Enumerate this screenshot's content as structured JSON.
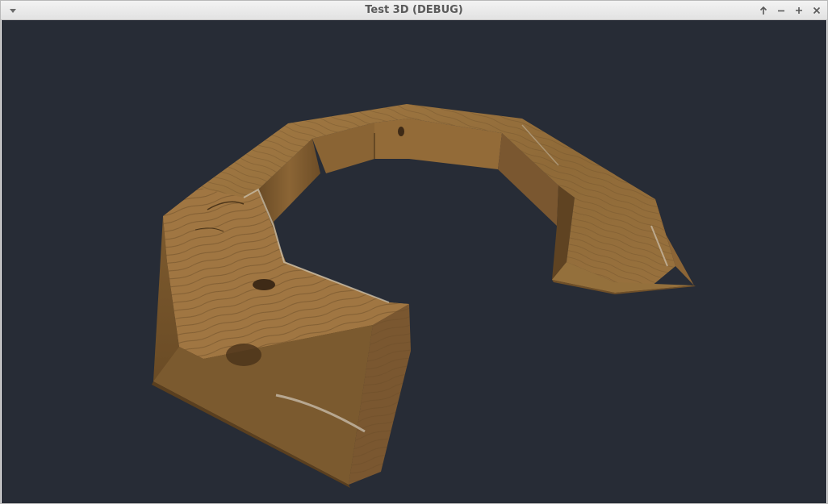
{
  "window": {
    "title": "Test 3D (DEBUG)"
  },
  "title_controls": [
    {
      "name": "window-menu-button",
      "icon": "chevron-down-icon"
    },
    {
      "name": "keep-above-button",
      "icon": "arrow-up-icon"
    },
    {
      "name": "minimize-button",
      "icon": "minus-icon"
    },
    {
      "name": "maximize-button",
      "icon": "plus-icon"
    },
    {
      "name": "close-button",
      "icon": "close-icon"
    }
  ],
  "scene": {
    "background_color": "#272c36",
    "object": "wooden-ring-segment",
    "wood_colors": {
      "light": "#a77c44",
      "mid": "#8a6434",
      "dark": "#6b4a24",
      "knot": "#3e2a16"
    }
  }
}
